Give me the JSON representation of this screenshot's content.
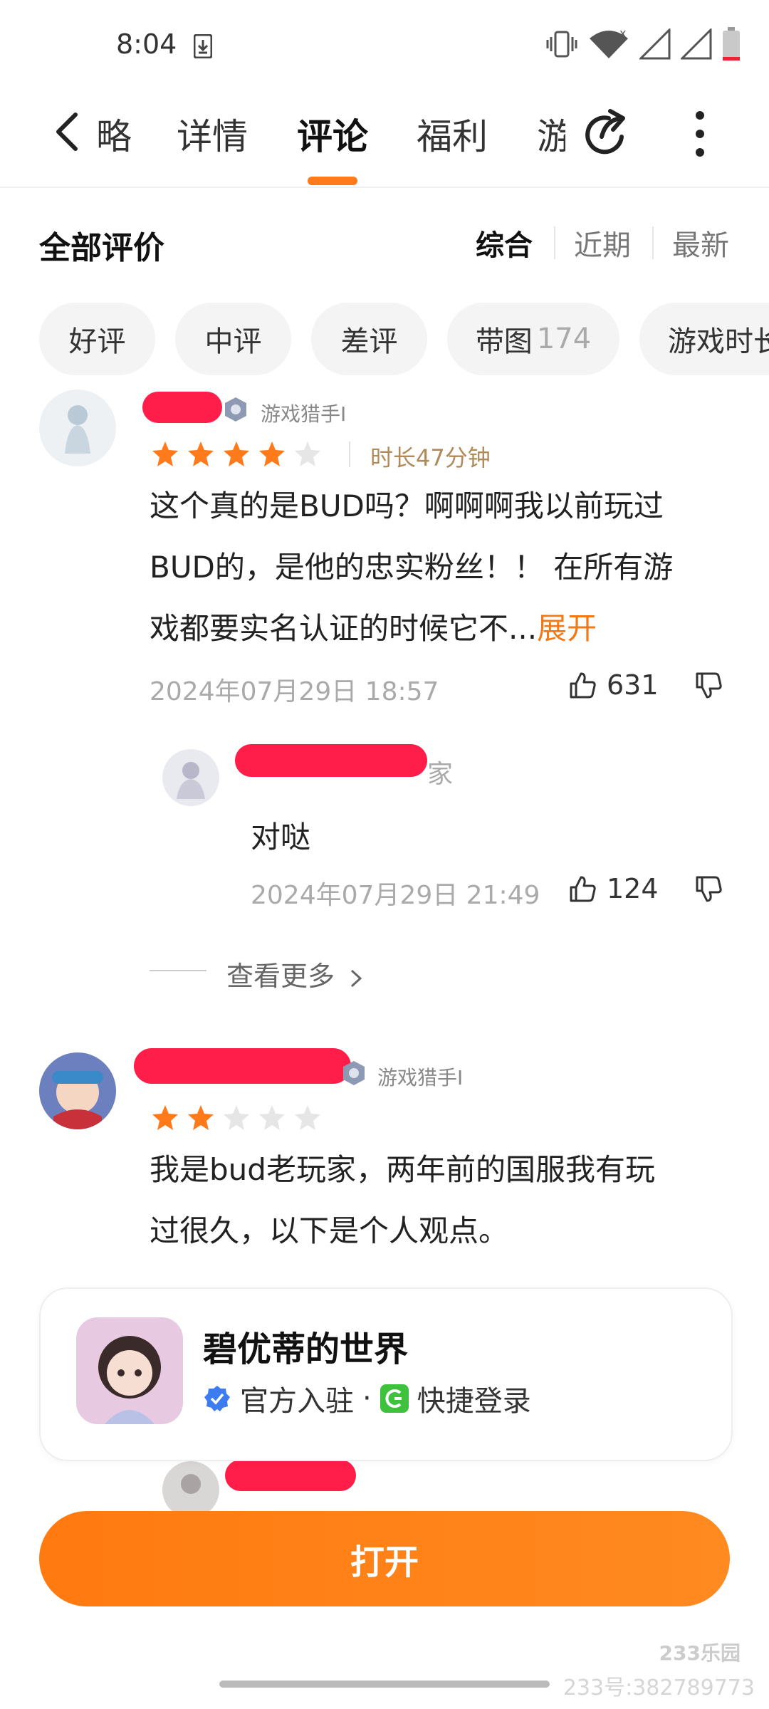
{
  "status_bar": {
    "time": "8:04",
    "icons": [
      "download-icon",
      "vibrate-icon",
      "wifi-icon",
      "signal-icon",
      "signal-icon",
      "battery-icon"
    ]
  },
  "nav": {
    "tabs": [
      {
        "label": "略"
      },
      {
        "label": "详情"
      },
      {
        "label": "评论"
      },
      {
        "label": "福利"
      },
      {
        "label": "游"
      }
    ],
    "active_tab": "评论"
  },
  "reviews_header": {
    "title": "全部评价",
    "sort": [
      "综合",
      "近期",
      "最新"
    ]
  },
  "filters": [
    {
      "label": "好评",
      "count": ""
    },
    {
      "label": "中评",
      "count": ""
    },
    {
      "label": "差评",
      "count": ""
    },
    {
      "label": "带图",
      "count": "174"
    },
    {
      "label": "游戏时长",
      "count": ""
    }
  ],
  "reviews": [
    {
      "badge": "游戏猎手I",
      "rating": 4,
      "duration": "时长47分钟",
      "lines": [
        "这个真的是BUD吗？啊啊啊我以前玩过",
        "BUD的，是他的忠实粉丝！！ 在所有游",
        "戏都要实名认证的时候它不..."
      ],
      "expand": "展开",
      "date": "2024年07月29日 18:57",
      "likes": "631",
      "reply": {
        "name_suffix": "家",
        "text": "对哒",
        "date": "2024年07月29日 21:49",
        "likes": "124"
      },
      "view_more": "查看更多"
    },
    {
      "badge": "游戏猎手I",
      "rating": 2,
      "lines": [
        "我是bud老玩家，两年前的国服我有玩",
        "过很久，以下是个人观点。"
      ]
    }
  ],
  "app_card": {
    "name": "碧优蒂的世界",
    "official": "官方入驻",
    "dot": "·",
    "quick_login": "快捷登录"
  },
  "open_button": "打开",
  "watermark": {
    "logo": "233乐园",
    "id": "233号:382789773"
  },
  "colors": {
    "accent": "#ff7a1a",
    "star": "#ff7a1a",
    "star_empty": "#e6e6e6",
    "redaction": "#ff1e4a"
  }
}
